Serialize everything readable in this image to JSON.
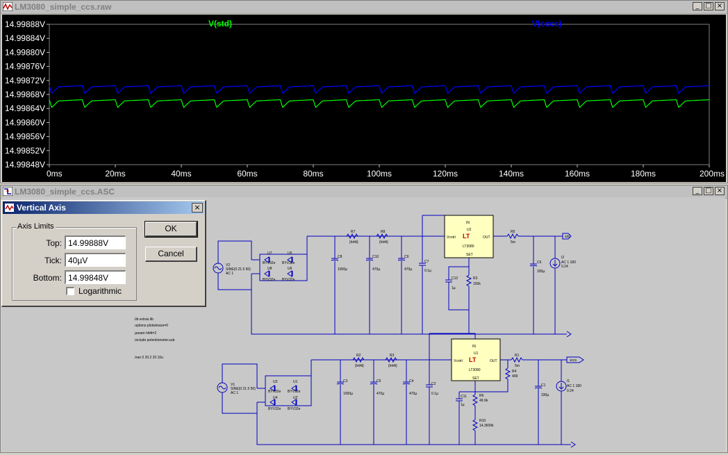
{
  "plot_window": {
    "title": "LM3080_simple_ccs.raw",
    "controls": [
      "_",
      "□",
      "×"
    ],
    "traces": [
      {
        "name": "V(std)",
        "color": "#00ff00"
      },
      {
        "name": "V(sccs)",
        "color": "#0000ff"
      }
    ],
    "y_ticks": [
      "14.99888V",
      "14.99884V",
      "14.99880V",
      "14.99876V",
      "14.99872V",
      "14.99868V",
      "14.99864V",
      "14.99860V",
      "14.99856V",
      "14.99852V",
      "14.99848V"
    ],
    "x_ticks": [
      "0ms",
      "20ms",
      "40ms",
      "60ms",
      "80ms",
      "100ms",
      "120ms",
      "140ms",
      "160ms",
      "180ms",
      "200ms"
    ]
  },
  "chart_data": {
    "type": "line",
    "xlabel": "",
    "ylabel": "",
    "xlim": [
      0,
      200
    ],
    "ylim": [
      14.99848,
      14.99888
    ],
    "grid": false,
    "ripple_period_ms": 10,
    "series": [
      {
        "name": "V(sccs)",
        "color": "#0000ff",
        "high": 14.998705,
        "low": 14.998683
      },
      {
        "name": "V(std)",
        "color": "#00ff00",
        "high": 14.998665,
        "low": 14.998643
      }
    ]
  },
  "schematic_window": {
    "title": "LM3080_simple_ccs.ASC",
    "controls": [
      "_",
      "□",
      "×"
    ],
    "directives": [
      ".lib extras.lib",
      ".options plotwinsize=0",
      ".param hit4t=2",
      ".include potentiometer.sub",
      ".tran 0 20.2 20 10u"
    ],
    "top_circuit": {
      "source_name": "V2",
      "source_value": "SINE(0 21.5 50)",
      "source_ac": "AC 1",
      "diodes": [
        {
          "ref": "U7",
          "part": "BYV32e"
        },
        {
          "ref": "U5",
          "part": "BYV32e"
        },
        {
          "ref": "U8",
          "part": "BYV32e"
        },
        {
          "ref": "U6",
          "part": "BYV32e"
        }
      ],
      "resistors": [
        {
          "ref": "R7",
          "value": "{hit4t}"
        },
        {
          "ref": "R8",
          "value": "{hit4t}"
        },
        {
          "ref": "R5",
          "value": "5m"
        },
        {
          "ref": "R3",
          "value": "150k"
        }
      ],
      "caps": [
        {
          "ref": "C8",
          "value": "1000µ"
        },
        {
          "ref": "C10",
          "value": "470µ"
        },
        {
          "ref": "C9",
          "value": "470µ"
        },
        {
          "ref": "C7",
          "value": "0.1µ"
        },
        {
          "ref": "C12",
          "value": "1µ"
        },
        {
          "ref": "C6",
          "value": "330µ"
        }
      ],
      "regulator": {
        "ref": "U2",
        "part": "LT3080",
        "pins": [
          "IN",
          "Vcntrl",
          "OUT",
          "SET"
        ]
      },
      "load": {
        "ref": "I2",
        "value": "AC 1 180",
        "value2": "0.24"
      },
      "net_label": "std"
    },
    "bottom_circuit": {
      "source_name": "V1",
      "source_value": "SINE(0 21.5 50)",
      "source_ac": "AC 1",
      "diodes": [
        {
          "ref": "U3",
          "part": "BYV32e"
        },
        {
          "ref": "U1",
          "part": "BYV32e"
        },
        {
          "ref": "U4",
          "part": "BYV32e"
        },
        {
          "ref": "U2",
          "part": "BYV32e"
        }
      ],
      "resistors": [
        {
          "ref": "R2",
          "value": "{hit4t}"
        },
        {
          "ref": "R3",
          "value": "{hit4t}"
        },
        {
          "ref": "R1",
          "value": "5m"
        },
        {
          "ref": "R4",
          "value": "499"
        },
        {
          "ref": "R6",
          "value": "49.9k"
        },
        {
          "ref": "R10",
          "value": "14.3609k"
        }
      ],
      "caps": [
        {
          "ref": "C3",
          "value": "1000µ"
        },
        {
          "ref": "C5",
          "value": "470µ"
        },
        {
          "ref": "C4",
          "value": "470µ"
        },
        {
          "ref": "C2",
          "value": "0.1µ"
        },
        {
          "ref": "C11",
          "value": "1µ"
        },
        {
          "ref": "C1",
          "value": "330µ"
        }
      ],
      "regulator": {
        "ref": "U1",
        "part": "LT3080",
        "pins": [
          "IN",
          "Vcntrl",
          "OUT",
          "SET"
        ]
      },
      "load": {
        "ref": "I1",
        "value": "AC 1 180",
        "value2": "0.24"
      },
      "net_label": "sccs"
    }
  },
  "dialog": {
    "title": "Vertical Axis",
    "close": "×",
    "group_label": "Axis Limits",
    "top_label": "Top:",
    "top_value": "14.99888V",
    "tick_label": "Tick:",
    "tick_value": "40µV",
    "bottom_label": "Bottom:",
    "bottom_value": "14.99848V",
    "log_label": "Logarithmic",
    "ok_label": "OK",
    "cancel_label": "Cancel"
  }
}
